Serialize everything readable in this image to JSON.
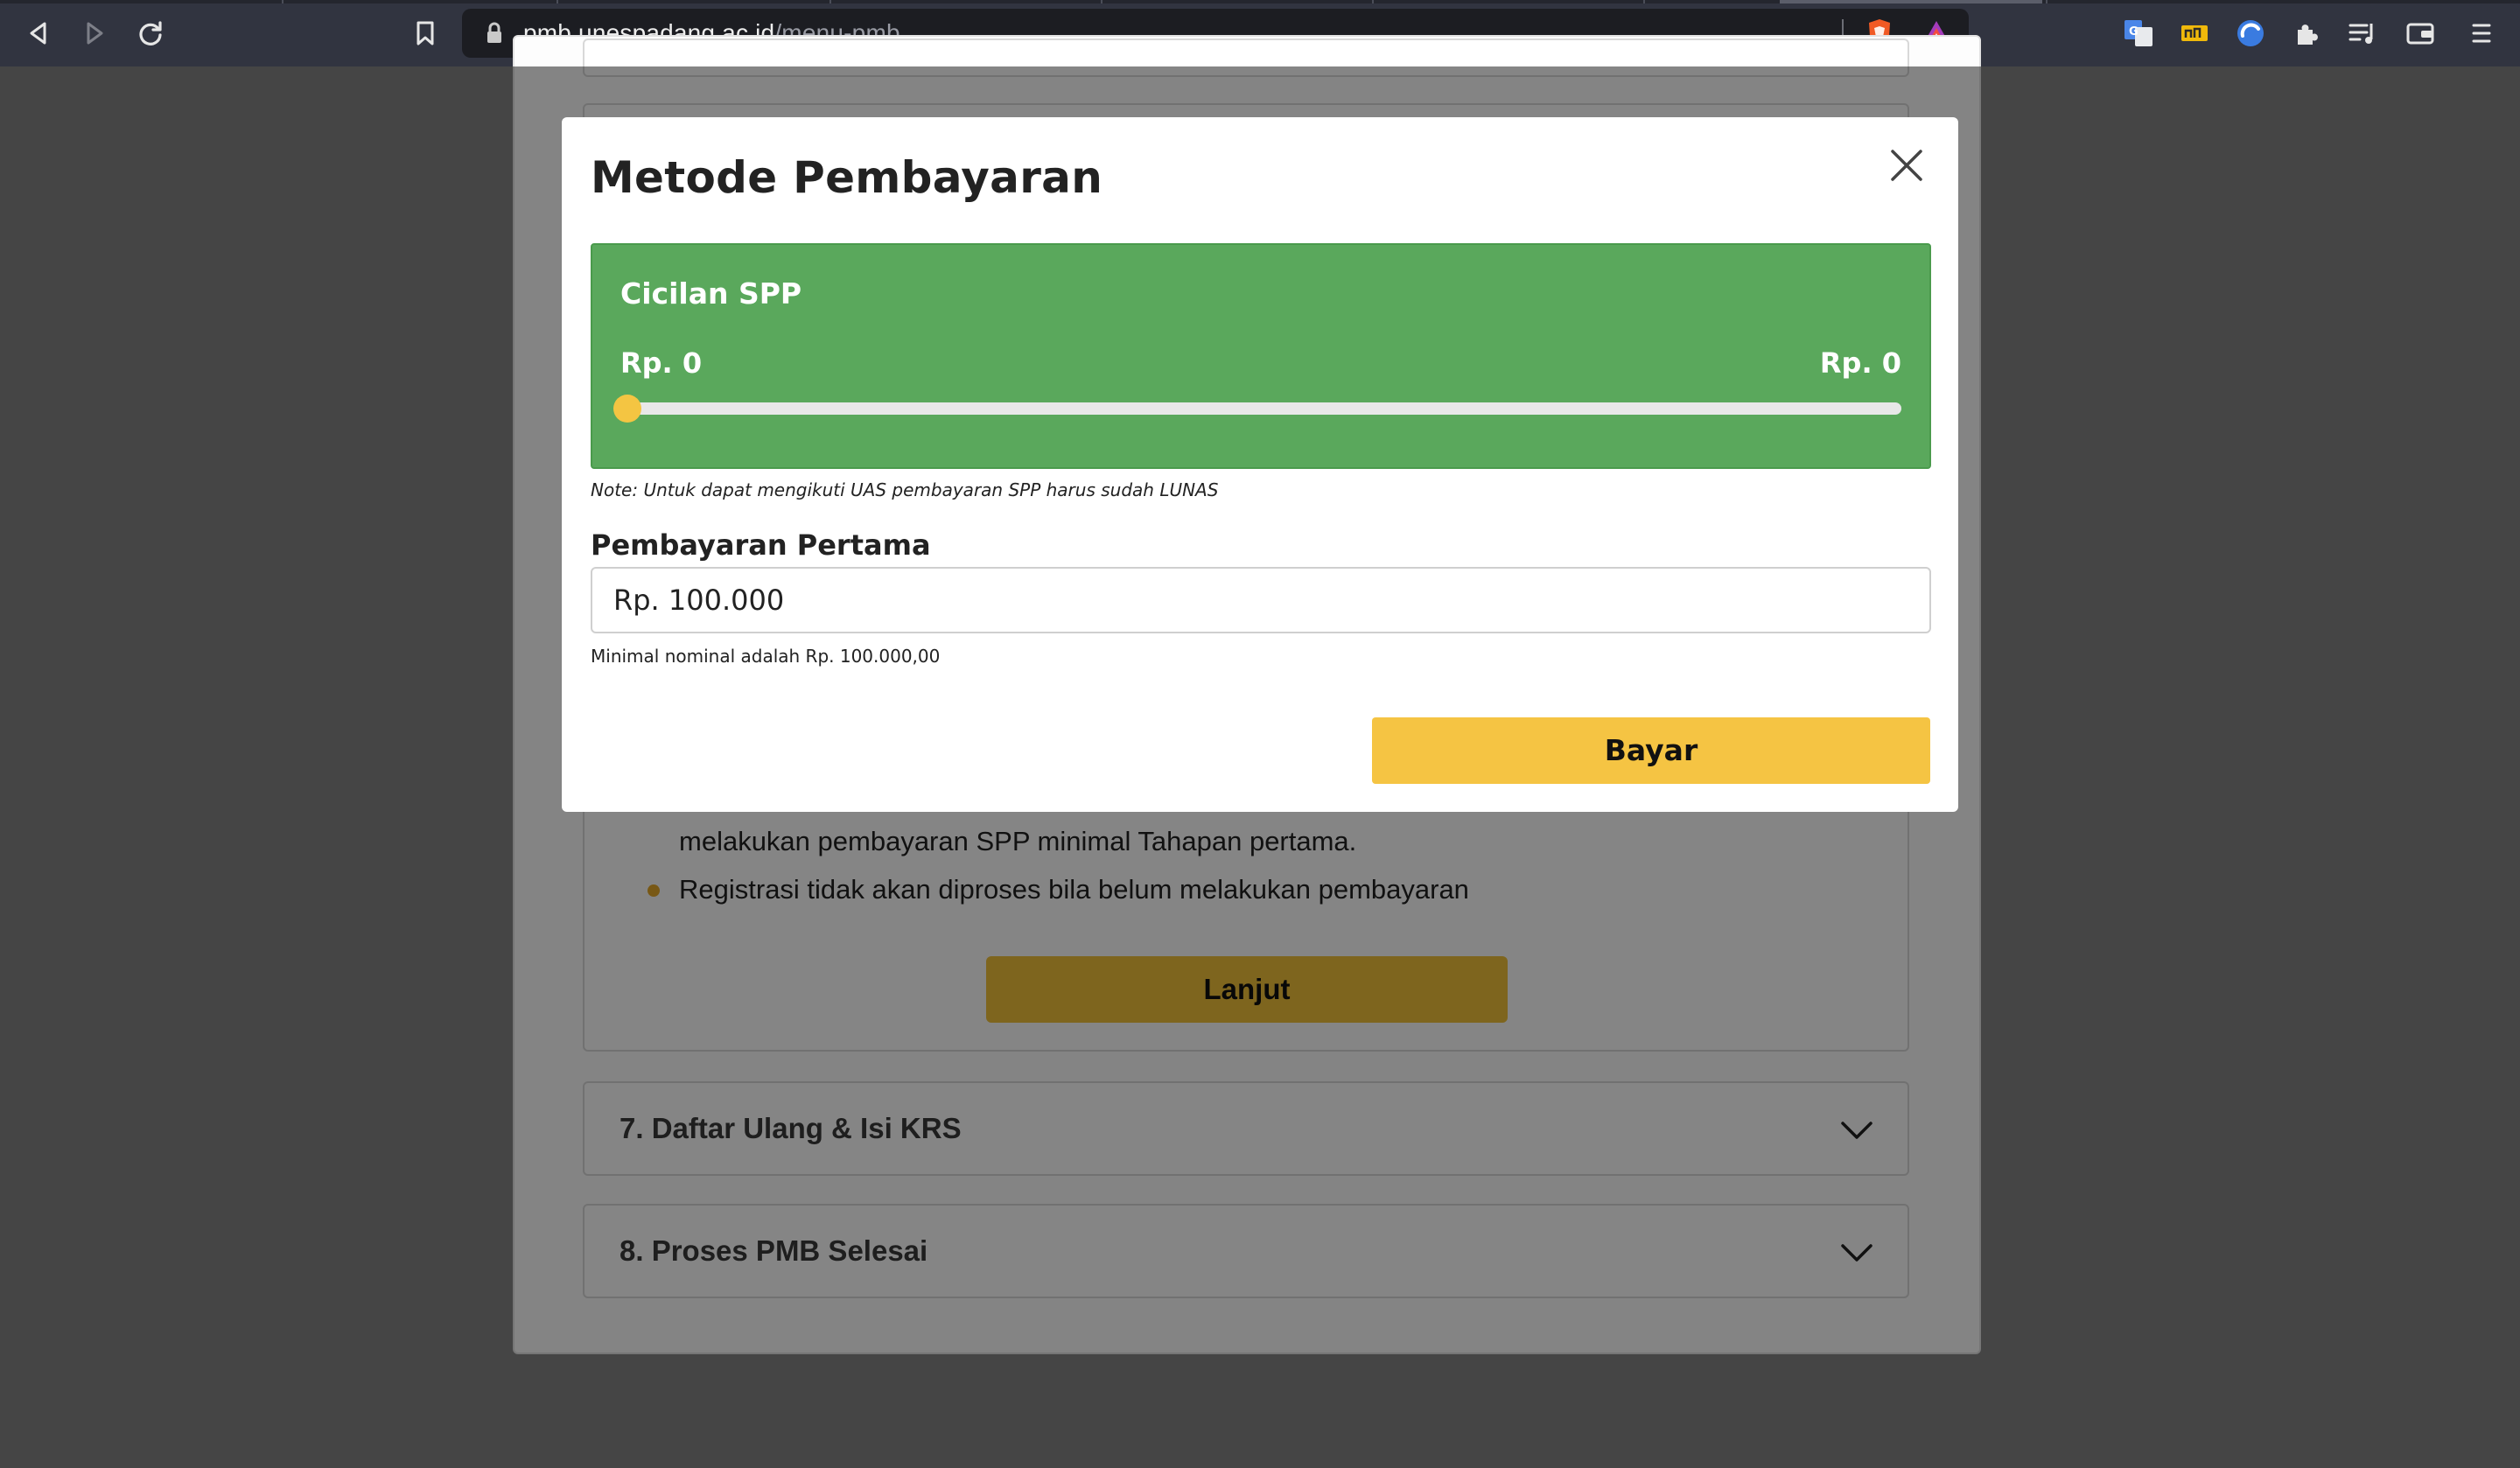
{
  "browser": {
    "url_host": "pmb.unespadang.ac.id",
    "url_path": "/menu-pmb",
    "icons": [
      "back-icon",
      "forward-icon",
      "reload-icon",
      "bookmark-icon",
      "lock-icon",
      "brave-shield-icon",
      "brave-rewards-icon",
      "google-translate-icon",
      "ext-icon",
      "ext-blue-circle-icon",
      "puzzle-icon",
      "playlist-icon",
      "wallet-icon",
      "menu-icon"
    ]
  },
  "modal": {
    "title": "Metode Pembayaran",
    "installment": {
      "title": "Cicilan SPP",
      "min_label": "Rp. 0",
      "max_label": "Rp. 0",
      "slider_fraction": 0
    },
    "note": "Note: Untuk dapat mengikuti UAS pembayaran SPP harus sudah LUNAS",
    "first_payment": {
      "label": "Pembayaran Pertama",
      "value": "Rp. 100.000",
      "helper": "Minimal nominal adalah Rp. 100.000,00"
    },
    "pay_button": "Bayar"
  },
  "background": {
    "bullet_1_line_2": "melakukan pembayaran SPP minimal Tahapan pertama.",
    "bullet_2": "Registrasi tidak akan diproses bila belum melakukan pembayaran",
    "continue_button": "Lanjut",
    "accordion": [
      {
        "title": "7. Daftar Ulang & Isi KRS"
      },
      {
        "title": "8. Proses PMB Selesai"
      }
    ]
  },
  "colors": {
    "accent_yellow": "#f5c443",
    "success_green": "#5aa85c",
    "toolbar": "#313440"
  }
}
